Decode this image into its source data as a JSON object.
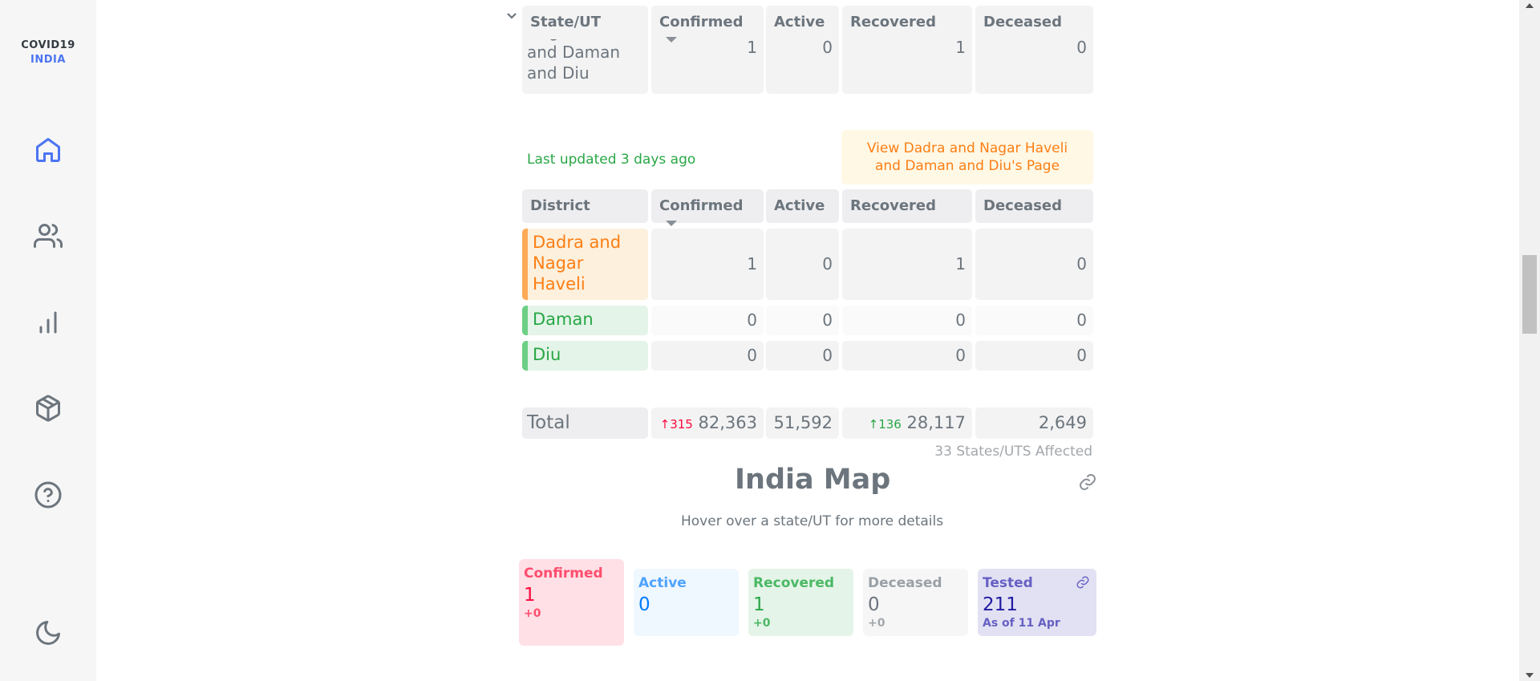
{
  "brand": {
    "line1": "COVID19",
    "line2": "INDIA"
  },
  "nav": [
    {
      "icon": "home-icon"
    },
    {
      "icon": "users-icon"
    },
    {
      "icon": "bar-chart-icon"
    },
    {
      "icon": "package-icon"
    },
    {
      "icon": "help-circle-icon"
    },
    {
      "icon": "moon-icon"
    }
  ],
  "state_table": {
    "headers": [
      "State/UT",
      "Confirmed",
      "Active",
      "Recovered",
      "Deceased"
    ],
    "partial_row": {
      "name_line1": "Nagar Haveli",
      "name_line2": "and Daman",
      "name_line3": "and Diu",
      "confirmed": "1",
      "active": "0",
      "recovered": "1",
      "deceased": "0"
    }
  },
  "last_updated": "Last updated 3 days ago",
  "view_page_button": {
    "line1": "View Dadra and Nagar Haveli",
    "line2": "and Daman and Diu's Page"
  },
  "district_table": {
    "headers": [
      "District",
      "Confirmed",
      "Active",
      "Recovered",
      "Deceased"
    ],
    "rows": [
      {
        "name_line1": "Dadra and",
        "name_line2": "Nagar",
        "name_line3": "Haveli",
        "confirmed": "1",
        "active": "0",
        "recovered": "1",
        "deceased": "0"
      },
      {
        "name": "Daman",
        "confirmed": "0",
        "active": "0",
        "recovered": "0",
        "deceased": "0"
      },
      {
        "name": "Diu",
        "confirmed": "0",
        "active": "0",
        "recovered": "0",
        "deceased": "0"
      }
    ]
  },
  "total": {
    "label": "Total",
    "confirmed_delta": "↑315",
    "confirmed": "82,363",
    "active": "51,592",
    "recovered_delta": "↑136",
    "recovered": "28,117",
    "deceased": "2,649"
  },
  "affected": "33 States/UTS Affected",
  "map": {
    "title": "India Map",
    "subtitle": "Hover over a state/UT for more details"
  },
  "stats": {
    "confirmed": {
      "label": "Confirmed",
      "value": "1",
      "delta": "+0"
    },
    "active": {
      "label": "Active",
      "value": "0"
    },
    "recovered": {
      "label": "Recovered",
      "value": "1",
      "delta": "+0"
    },
    "deceased": {
      "label": "Deceased",
      "value": "0",
      "delta": "+0"
    },
    "tested": {
      "label": "Tested",
      "value": "211",
      "note": "As of 11 Apr"
    }
  },
  "colors": {
    "accent": "#4c75f2",
    "confirmed": "#ff073a",
    "active": "#007bff",
    "recovered": "#28a745",
    "deceased": "#6c757d",
    "tested": "#201aa2",
    "orange": "#fd7e14"
  }
}
